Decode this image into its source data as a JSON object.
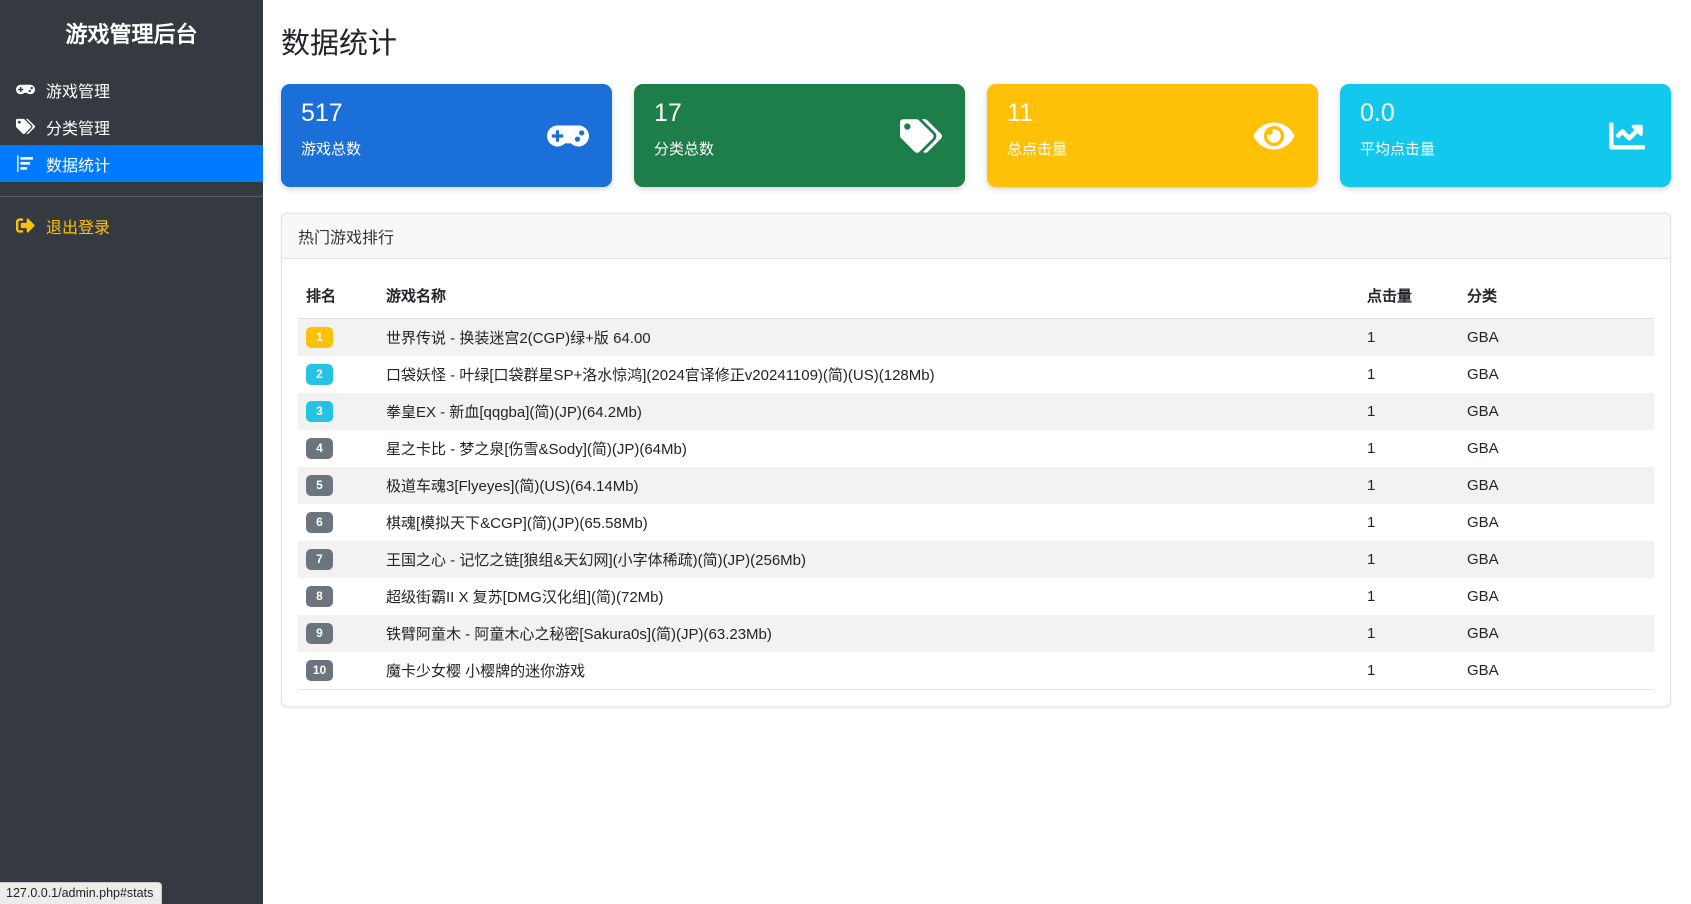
{
  "app": {
    "title": "游戏管理后台"
  },
  "sidebar": {
    "items": [
      {
        "label": "游戏管理",
        "icon": "gamepad-icon",
        "active": false
      },
      {
        "label": "分类管理",
        "icon": "tags-icon",
        "active": false
      },
      {
        "label": "数据统计",
        "icon": "chart-bar-icon",
        "active": true
      }
    ],
    "logout_label": "退出登录"
  },
  "page": {
    "title": "数据统计"
  },
  "stats_cards": [
    {
      "value": "517",
      "label": "游戏总数",
      "icon": "gamepad-icon",
      "color": "#1a6fd8"
    },
    {
      "value": "17",
      "label": "分类总数",
      "icon": "tags-icon",
      "color": "#1e7e4a"
    },
    {
      "value": "11",
      "label": "总点击量",
      "icon": "eye-icon",
      "color": "#ffc107"
    },
    {
      "value": "0.0",
      "label": "平均点击量",
      "icon": "chart-line-icon",
      "color": "#12c8ec"
    }
  ],
  "ranking": {
    "title": "热门游戏排行",
    "columns": {
      "rank": "排名",
      "name": "游戏名称",
      "clicks": "点击量",
      "category": "分类"
    },
    "rows": [
      {
        "rank": "1",
        "name": "世界传说 - 换装迷宫2(CGP)绿+版 64.00",
        "clicks": "1",
        "category": "GBA",
        "badge_color": "#ffc107"
      },
      {
        "rank": "2",
        "name": "口袋妖怪 - 叶绿[口袋群星SP+洛水惊鸿](2024官译修正v20241109)(简)(US)(128Mb)",
        "clicks": "1",
        "category": "GBA",
        "badge_color": "#24c3e4"
      },
      {
        "rank": "3",
        "name": "拳皇EX - 新血[qqgba](简)(JP)(64.2Mb)",
        "clicks": "1",
        "category": "GBA",
        "badge_color": "#24c3e4"
      },
      {
        "rank": "4",
        "name": "星之卡比 - 梦之泉[伤雪&Sody](简)(JP)(64Mb)",
        "clicks": "1",
        "category": "GBA",
        "badge_color": "#6c757d"
      },
      {
        "rank": "5",
        "name": "极道车魂3[Flyeyes](简)(US)(64.14Mb)",
        "clicks": "1",
        "category": "GBA",
        "badge_color": "#6c757d"
      },
      {
        "rank": "6",
        "name": "棋魂[模拟天下&CGP](简)(JP)(65.58Mb)",
        "clicks": "1",
        "category": "GBA",
        "badge_color": "#6c757d"
      },
      {
        "rank": "7",
        "name": "王国之心 - 记忆之链[狼组&天幻网](小字体稀疏)(简)(JP)(256Mb)",
        "clicks": "1",
        "category": "GBA",
        "badge_color": "#6c757d"
      },
      {
        "rank": "8",
        "name": "超级街霸II X 复苏[DMG汉化组](简)(72Mb)",
        "clicks": "1",
        "category": "GBA",
        "badge_color": "#6c757d"
      },
      {
        "rank": "9",
        "name": "铁臂阿童木 - 阿童木心之秘密[Sakura0s](简)(JP)(63.23Mb)",
        "clicks": "1",
        "category": "GBA",
        "badge_color": "#6c757d"
      },
      {
        "rank": "10",
        "name": "魔卡少女樱 小樱牌的迷你游戏",
        "clicks": "1",
        "category": "GBA",
        "badge_color": "#6c757d"
      }
    ]
  },
  "status_bar": {
    "url": "127.0.0.1/admin.php#stats"
  },
  "colors": {
    "sidebar_bg": "#343a40",
    "nav_active": "#007bff",
    "logout_text": "#ffc107",
    "card_blue": "#1a6fd8",
    "card_green": "#1e7e4a",
    "card_amber": "#ffc107",
    "card_cyan": "#12c8ec",
    "badge_gray": "#6c757d",
    "row_stripe": "#f2f2f2"
  }
}
